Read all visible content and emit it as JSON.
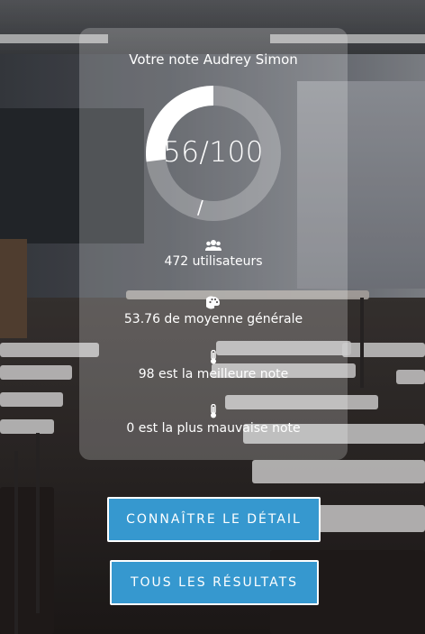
{
  "card": {
    "title": "Votre note Audrey Simon",
    "score_text": "56/100",
    "score_value": 56,
    "score_max": 100,
    "slash": "/"
  },
  "stats": [
    {
      "icon": "users-icon",
      "text": "472 utilisateurs"
    },
    {
      "icon": "palette-icon",
      "text": "53.76 de moyenne générale"
    },
    {
      "icon": "thermometer-icon",
      "text": "98 est la meilleure note"
    },
    {
      "icon": "thermometer-icon",
      "text": "0 est la plus mauvaise note"
    }
  ],
  "buttons": {
    "detail": "CONNAÎTRE LE DÉTAIL",
    "results": "TOUS LES RÉSULTATS"
  },
  "colors": {
    "button": "#3698cf",
    "gauge_fill": "#ffffff",
    "gauge_track": "rgba(255,255,255,0.25)"
  }
}
